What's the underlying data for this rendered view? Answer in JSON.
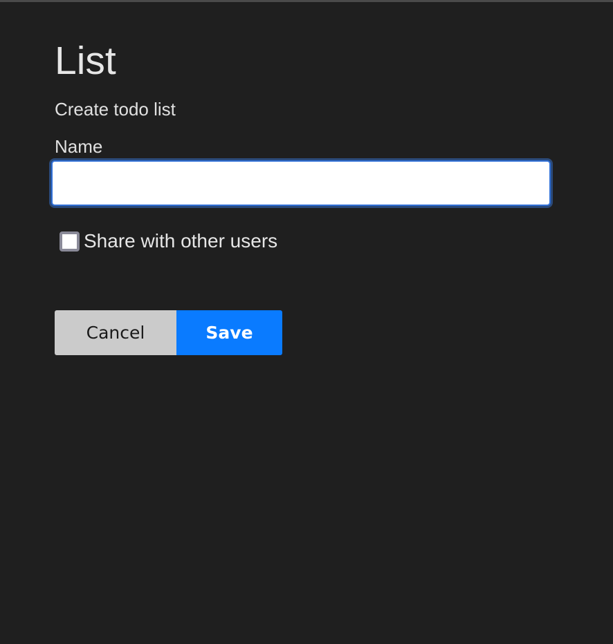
{
  "page": {
    "title": "List",
    "subtitle": "Create todo list"
  },
  "form": {
    "name_label": "Name",
    "name_value": "",
    "name_placeholder": "",
    "share_checked": false,
    "share_label": "Share with other users"
  },
  "actions": {
    "cancel_label": "Cancel",
    "save_label": "Save"
  },
  "colors": {
    "background": "#1f1f1f",
    "primary": "#0a7bff",
    "secondary": "#cbcbcb",
    "focus_ring": "#2f6fd6"
  }
}
